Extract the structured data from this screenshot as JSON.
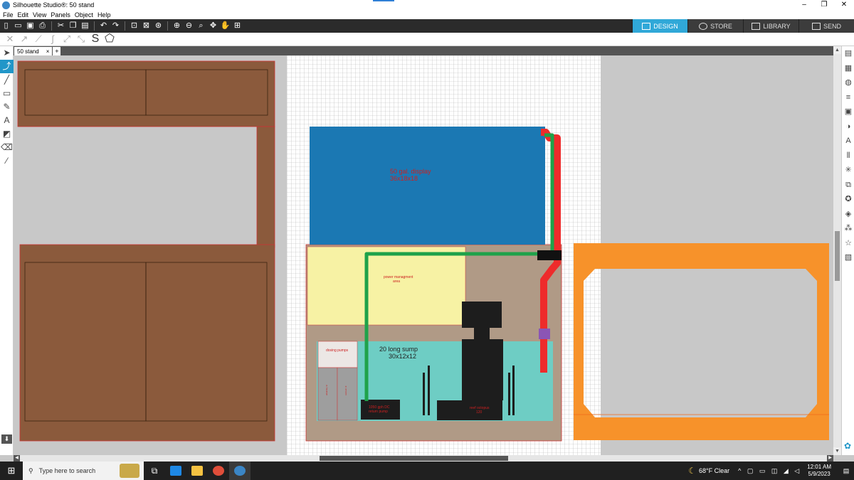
{
  "window": {
    "title": "Silhouette Studio®: 50 stand",
    "minimize": "–",
    "maximize": "❐",
    "close": "✕"
  },
  "menu": [
    "File",
    "Edit",
    "View",
    "Panels",
    "Object",
    "Help"
  ],
  "nav_tabs": [
    {
      "label": "DESIGN",
      "icon": "grid-icon",
      "active": true
    },
    {
      "label": "STORE",
      "icon": "store-icon",
      "active": false
    },
    {
      "label": "LIBRARY",
      "icon": "library-icon",
      "active": false
    },
    {
      "label": "SEND",
      "icon": "send-icon",
      "active": false
    }
  ],
  "document_tab": {
    "name": "50 stand",
    "close": "×",
    "add": "+"
  },
  "canvas": {
    "display_tank": {
      "line1": "50 gal. display",
      "line2": "36x18x18",
      "color": "#1b78b3"
    },
    "power_area": {
      "line1": "power managment",
      "line2": "area",
      "color": "#f7f2a4"
    },
    "sump": {
      "line1": "20 long sump",
      "line2": "30x12x12",
      "color": "#6ecdc4"
    },
    "dosing_pumps": "dosing pumps",
    "alkalinity_label": "alkalinity 3l",
    "calcium_label": "calcium 3l",
    "return_pump": {
      "line1": "1050 gph DC",
      "line2": "return pump"
    },
    "skimmer": {
      "line1": "reef octopus",
      "line2": "120"
    },
    "colors": {
      "cabinet": "#8b5a3c",
      "stand": "#b09a86",
      "frame": "#f7922a",
      "drain_pipe": "#ee2b2b",
      "return_pipe": "#1fa24a"
    }
  },
  "taskbar": {
    "search_placeholder": "Type here to search",
    "weather": "68°F  Clear",
    "time": "12:01 AM",
    "date": "5/9/2023"
  }
}
